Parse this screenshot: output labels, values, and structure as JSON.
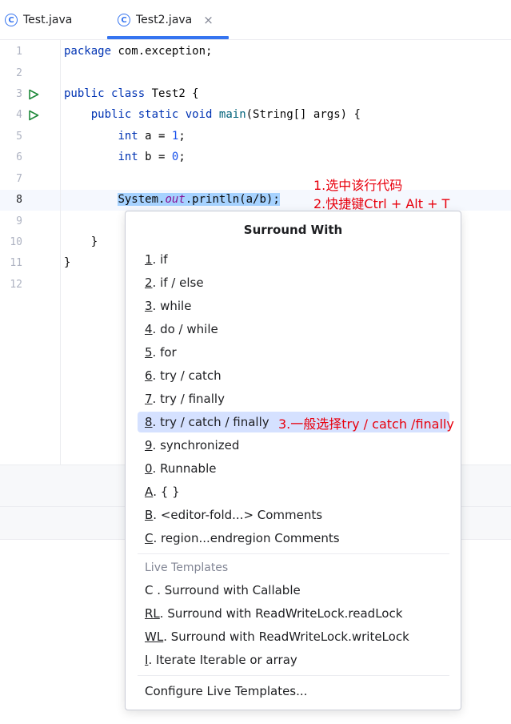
{
  "tabs": [
    {
      "label": "Test.java",
      "active": false
    },
    {
      "label": "Test2.java",
      "active": true
    }
  ],
  "tab_close_glyph": "×",
  "tab_icon_glyph": "C",
  "editor": {
    "line_numbers": [
      "1",
      "2",
      "3",
      "4",
      "5",
      "6",
      "7",
      "8",
      "9",
      "10",
      "11",
      "12"
    ],
    "active_line": "8",
    "line1": {
      "kw": "package",
      "rest": " com.exception;"
    },
    "line3": {
      "kw1": "public",
      "kw2": "class",
      "rest": " Test2 {"
    },
    "line4": {
      "indent": "    ",
      "kw1": "public",
      "kw2": "static",
      "kw3": "void",
      "fn": "main",
      "rest": "(String[] args) {"
    },
    "line5": {
      "indent": "        ",
      "kw": "int",
      "mid": " a = ",
      "num": "1",
      "end": ";"
    },
    "line6": {
      "indent": "        ",
      "kw": "int",
      "mid": " b = ",
      "num": "0",
      "end": ";"
    },
    "line8": {
      "indent": "        ",
      "pre": "System.",
      "ital": "out",
      "post": ".println(a/b);"
    },
    "line10": {
      "text": "    }"
    },
    "line11": {
      "text": "}"
    }
  },
  "annotations": {
    "step1": "1.选中该行代码",
    "step2": "2.快捷键Ctrl + Alt + T",
    "step3": "3.一般选择try / catch /finally"
  },
  "popup": {
    "title": "Surround With",
    "items": [
      {
        "mnemonic": "1",
        "label": ". if"
      },
      {
        "mnemonic": "2",
        "label": ". if / else"
      },
      {
        "mnemonic": "3",
        "label": ". while"
      },
      {
        "mnemonic": "4",
        "label": ". do / while"
      },
      {
        "mnemonic": "5",
        "label": ". for"
      },
      {
        "mnemonic": "6",
        "label": ". try / catch"
      },
      {
        "mnemonic": "7",
        "label": ". try / finally"
      },
      {
        "mnemonic": "8",
        "label": ". try / catch / finally",
        "selected": true
      },
      {
        "mnemonic": "9",
        "label": ". synchronized"
      },
      {
        "mnemonic": "0",
        "label": ". Runnable"
      },
      {
        "mnemonic": "A",
        "label": ". { }"
      },
      {
        "mnemonic": "B",
        "label": ". <editor-fold...> Comments"
      },
      {
        "mnemonic": "C",
        "label": ". region...endregion Comments"
      }
    ],
    "live_templates_label": "Live Templates",
    "live_items": [
      {
        "mnemonic": "",
        "label": "C . Surround with Callable"
      },
      {
        "mnemonic": "RL",
        "label": ". Surround with ReadWriteLock.readLock"
      },
      {
        "mnemonic": "WL",
        "label": ". Surround with ReadWriteLock.writeLock"
      },
      {
        "mnemonic": "I",
        "label": ". Iterate Iterable or array"
      }
    ],
    "configure_label": "Configure Live Templates..."
  },
  "colors": {
    "accent": "#3574f0",
    "annotation": "#e8000d",
    "selection": "#a6d2ff",
    "selected_item": "#d5e1ff"
  }
}
